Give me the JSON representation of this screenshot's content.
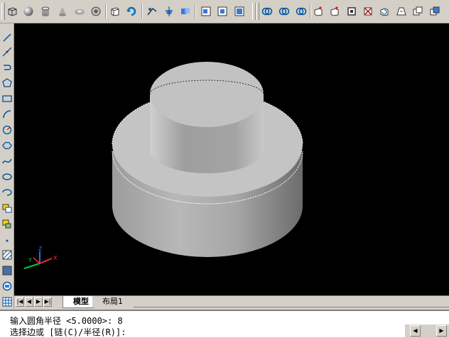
{
  "toolbar": {
    "icons": [
      "box-icon",
      "sphere-icon",
      "cylinder-icon",
      "cone-icon",
      "wedge-icon",
      "torus-icon",
      "extrude-icon",
      "revolve-icon",
      "slice-icon",
      "section-icon",
      "interfere-icon",
      "setup-drawing-icon",
      "setup-view-icon",
      "setup-profile-icon",
      "union-icon",
      "subtract-icon",
      "intersect-icon",
      "extrude-faces-icon",
      "move-faces-icon",
      "offset-faces-icon",
      "delete-faces-icon",
      "rotate-faces-icon",
      "taper-faces-icon",
      "copy-faces-icon",
      "color-faces-icon"
    ]
  },
  "left_toolbar": {
    "icons": [
      "line-icon",
      "construction-line-icon",
      "polyline-icon",
      "polygon-icon",
      "rectangle-icon",
      "arc-icon",
      "circle-icon",
      "revision-cloud-icon",
      "spline-icon",
      "ellipse-icon",
      "ellipse-arc-icon",
      "insert-block-icon",
      "make-block-icon",
      "point-icon",
      "hatch-icon",
      "region-icon",
      "table-icon"
    ]
  },
  "ucs": {
    "x": "X",
    "y": "Y",
    "z": "Z"
  },
  "tabs": {
    "nav": [
      "|◀",
      "◀",
      "▶",
      "▶|"
    ],
    "items": [
      {
        "label": "模型",
        "active": true
      },
      {
        "label": "布局1",
        "active": false
      }
    ]
  },
  "command": {
    "line1": "输入圆角半径 <5.0000>: 8",
    "line2": "选择边或 [链(C)/半径(R)]:"
  },
  "colors": {
    "viewport_bg": "#000000",
    "ui_face": "#d4d0c8",
    "solid_face": "#c0c0c0"
  }
}
